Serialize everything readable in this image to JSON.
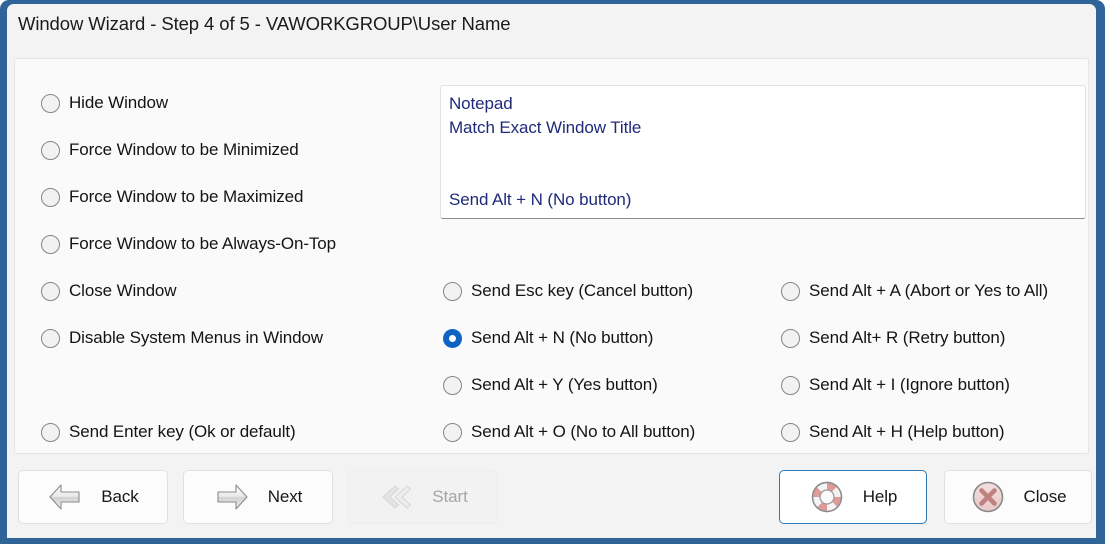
{
  "window": {
    "title": "Window Wizard - Step 4 of 5 - VAWORKGROUP\\User Name",
    "frame_color": "#2f6498",
    "accent_color": "#0e63c3"
  },
  "summary_box": {
    "lines": [
      "Notepad",
      "Match Exact Window Title",
      "",
      "Send Alt + N (No button)"
    ],
    "text_color": "#1f2a7a"
  },
  "left_options": [
    {
      "label": "Hide Window",
      "checked": false
    },
    {
      "label": "Force Window to be Minimized",
      "checked": false
    },
    {
      "label": "Force Window to be Maximized",
      "checked": false
    },
    {
      "label": "Force Window to be Always-On-Top",
      "checked": false
    },
    {
      "label": "Close Window",
      "checked": false
    },
    {
      "label": "Disable System Menus in Window",
      "checked": false
    },
    {
      "label": "Send Enter key (Ok or default)",
      "checked": false
    }
  ],
  "middle_options": [
    {
      "label": "Send Esc key (Cancel button)",
      "checked": false
    },
    {
      "label": "Send Alt + N (No button)",
      "checked": true
    },
    {
      "label": "Send Alt + Y (Yes button)",
      "checked": false
    },
    {
      "label": "Send Alt + O (No to All button)",
      "checked": false
    }
  ],
  "right_options": [
    {
      "label": "Send Alt + A (Abort or Yes to All)",
      "checked": false
    },
    {
      "label": "Send Alt+ R (Retry button)",
      "checked": false
    },
    {
      "label": "Send Alt + I (Ignore button)",
      "checked": false
    },
    {
      "label": "Send Alt + H (Help button)",
      "checked": false
    }
  ],
  "buttons": {
    "back": {
      "label": "Back",
      "icon": "arrow-left-icon",
      "enabled": true
    },
    "next": {
      "label": "Next",
      "icon": "arrow-right-icon",
      "enabled": true
    },
    "start": {
      "label": "Start",
      "icon": "double-chevron-left-icon",
      "enabled": false
    },
    "help": {
      "label": "Help",
      "icon": "lifebuoy-icon",
      "enabled": true,
      "focused": true
    },
    "close": {
      "label": "Close",
      "icon": "close-circle-icon",
      "enabled": true
    }
  }
}
